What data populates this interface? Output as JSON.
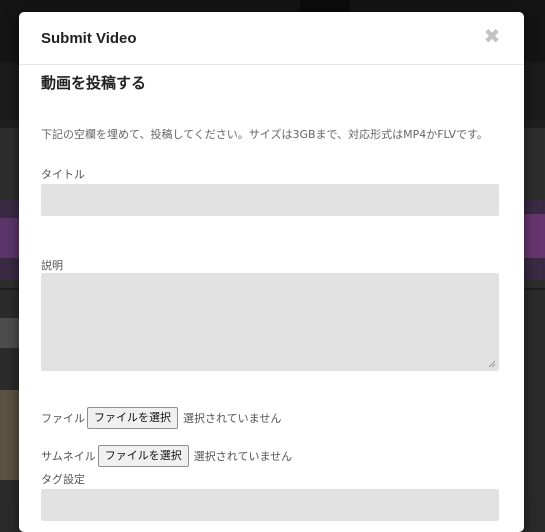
{
  "modal": {
    "title": "Submit Video",
    "close_symbol": "✖",
    "heading": "動画を投稿する",
    "instructions": "下記の空欄を埋めて、投稿してください。サイズは3GBまで、対応形式はMP4かFLVです。"
  },
  "form": {
    "title_label": "タイトル",
    "title_value": "",
    "description_label": "説明",
    "description_value": "",
    "file_label": "ファイル",
    "file_button": "ファイルを選択",
    "file_status": "選択されていません",
    "thumbnail_label": "サムネイル",
    "thumbnail_button": "ファイルを選択",
    "thumbnail_status": "選択されていません",
    "tags_label": "タグ設定",
    "tags_value": ""
  },
  "icons": {
    "close": "close-icon",
    "resize": "resize-grip-icon"
  },
  "colors": {
    "overlay": "#1f1f1f",
    "modal_bg": "#ffffff",
    "input_bg": "#e2e2e2",
    "close_icon": "#c3c3c3"
  }
}
